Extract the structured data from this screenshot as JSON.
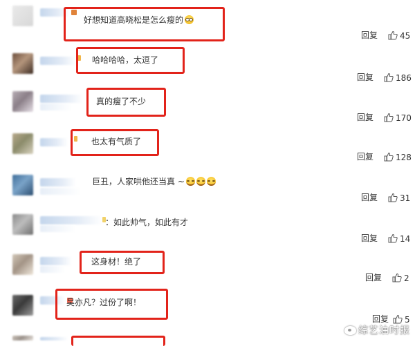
{
  "colors": {
    "highlight": "#e2231a",
    "text": "#333333",
    "divider": "#eeeeee"
  },
  "comments": [
    {
      "text": "好想知道高晓松是怎么瘦的",
      "emoji": [
        "sunglasses-emoji"
      ],
      "reply": "回复",
      "likes": "45"
    },
    {
      "text": "哈哈哈哈，太逗了",
      "emoji": [],
      "reply": "回复",
      "likes": "186"
    },
    {
      "text": "真的瘦了不少",
      "emoji": [],
      "reply": "回复",
      "likes": "170"
    },
    {
      "text": "也太有气质了",
      "emoji": [],
      "reply": "回复",
      "likes": "128"
    },
    {
      "text": "巨丑，人家哄他还当真 ~",
      "emoji": [
        "laugh-cry-emoji",
        "laugh-cry-emoji",
        "laugh-cry-emoji"
      ],
      "reply": "回复",
      "likes": "31"
    },
    {
      "text": "：如此帅气，如此有才",
      "emoji": [],
      "reply": "回复",
      "likes": "14"
    },
    {
      "text": "这身材！绝了",
      "emoji": [],
      "reply": "回复",
      "likes": "2"
    },
    {
      "text": "吴亦凡？过份了啊！",
      "emoji": [],
      "reply": "回复",
      "likes": "5"
    }
  ],
  "watermark": {
    "icon": "weibo-logo-icon",
    "text": "综艺油时报"
  }
}
